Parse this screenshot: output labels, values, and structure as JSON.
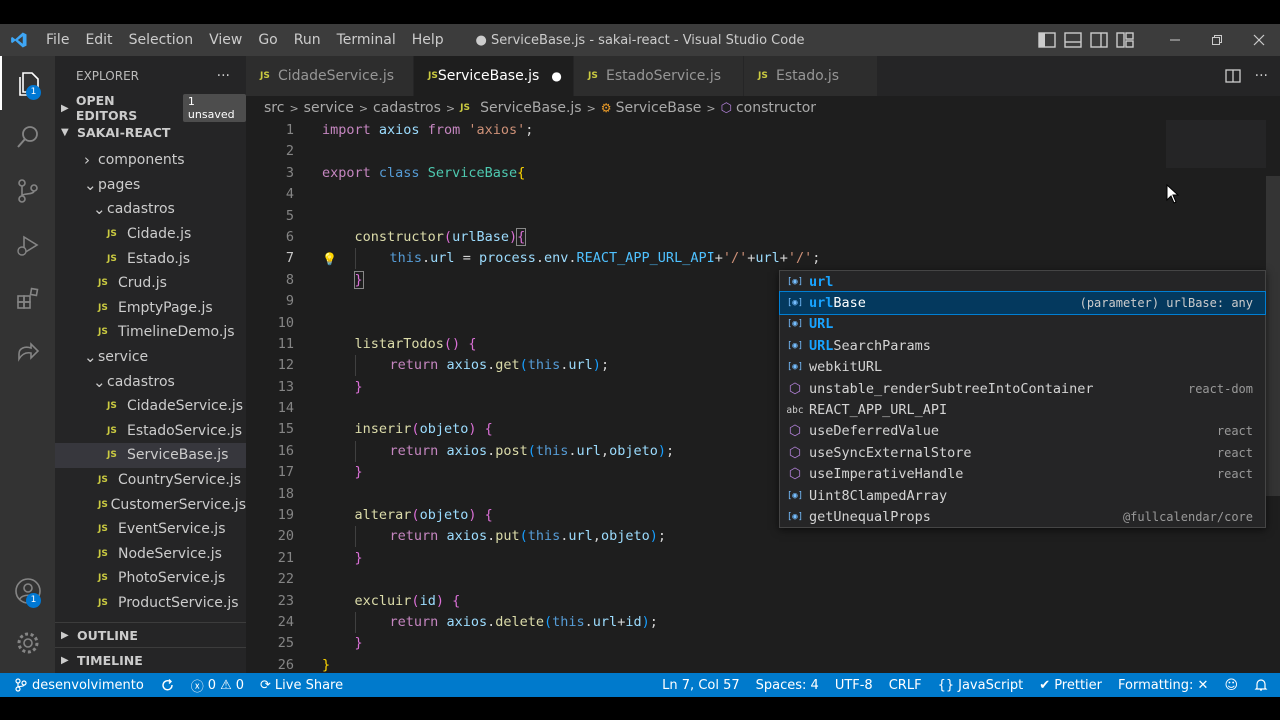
{
  "window": {
    "title": "● ServiceBase.js - sakai-react - Visual Studio Code",
    "menu": [
      "File",
      "Edit",
      "Selection",
      "View",
      "Go",
      "Run",
      "Terminal",
      "Help"
    ]
  },
  "activity_bar": {
    "items": [
      "explorer-icon",
      "search-icon",
      "source-control-icon",
      "run-debug-icon",
      "extensions-icon",
      "live-share-icon"
    ],
    "explorer_badge": "1",
    "accounts_badge": "1"
  },
  "sidebar": {
    "title": "EXPLORER",
    "more": "···",
    "open_editors": "OPEN EDITORS",
    "unsaved_badge": "1 unsaved",
    "project": "SAKAI-REACT",
    "tree": [
      {
        "label": "components",
        "type": "folder",
        "depth": 1,
        "open": false
      },
      {
        "label": "pages",
        "type": "folder",
        "depth": 1,
        "open": true
      },
      {
        "label": "cadastros",
        "type": "folder",
        "depth": 2,
        "open": true
      },
      {
        "label": "Cidade.js",
        "type": "file",
        "depth": 3
      },
      {
        "label": "Estado.js",
        "type": "file",
        "depth": 3
      },
      {
        "label": "Crud.js",
        "type": "file",
        "depth": 2
      },
      {
        "label": "EmptyPage.js",
        "type": "file",
        "depth": 2
      },
      {
        "label": "TimelineDemo.js",
        "type": "file",
        "depth": 2
      },
      {
        "label": "service",
        "type": "folder",
        "depth": 1,
        "open": true
      },
      {
        "label": "cadastros",
        "type": "folder",
        "depth": 2,
        "open": true
      },
      {
        "label": "CidadeService.js",
        "type": "file",
        "depth": 3
      },
      {
        "label": "EstadoService.js",
        "type": "file",
        "depth": 3
      },
      {
        "label": "ServiceBase.js",
        "type": "file",
        "depth": 3,
        "selected": true
      },
      {
        "label": "CountryService.js",
        "type": "file",
        "depth": 2
      },
      {
        "label": "CustomerService.js",
        "type": "file",
        "depth": 2
      },
      {
        "label": "EventService.js",
        "type": "file",
        "depth": 2
      },
      {
        "label": "NodeService.js",
        "type": "file",
        "depth": 2
      },
      {
        "label": "PhotoService.js",
        "type": "file",
        "depth": 2
      },
      {
        "label": "ProductService.js",
        "type": "file",
        "depth": 2
      }
    ],
    "outline": "OUTLINE",
    "timeline": "TIMELINE",
    "js_icon": "JS"
  },
  "tabs": [
    {
      "label": "CidadeService.js",
      "active": false
    },
    {
      "label": "ServiceBase.js",
      "active": true,
      "dirty": true
    },
    {
      "label": "EstadoService.js",
      "active": false
    },
    {
      "label": "Estado.js",
      "active": false
    }
  ],
  "breadcrumb": [
    "src",
    "service",
    "cadastros",
    "ServiceBase.js",
    "ServiceBase",
    "constructor"
  ],
  "code": {
    "line_numbers": [
      "1",
      "2",
      "3",
      "4",
      "5",
      "6",
      "7",
      "8",
      "9",
      "10",
      "11",
      "12",
      "13",
      "14",
      "15",
      "16",
      "17",
      "18",
      "19",
      "20",
      "21",
      "22",
      "23",
      "24",
      "25",
      "26"
    ],
    "current_line": "7"
  },
  "suggestions": [
    {
      "label": "url",
      "match": "url",
      "rest": "",
      "icon": "variable",
      "detail": ""
    },
    {
      "label": "urlBase",
      "match": "url",
      "rest": "Base",
      "icon": "variable",
      "detail": "(parameter) urlBase: any",
      "selected": true
    },
    {
      "label": "URL",
      "match": "URL",
      "rest": "",
      "icon": "variable",
      "detail": ""
    },
    {
      "label": "URLSearchParams",
      "match": "URL",
      "rest": "SearchParams",
      "icon": "variable",
      "detail": ""
    },
    {
      "label": "webkitURL",
      "match": "",
      "rest": "webkitURL",
      "icon": "variable",
      "detail": ""
    },
    {
      "label": "unstable_renderSubtreeIntoContainer",
      "match": "",
      "rest": "unstable_renderSubtreeIntoContainer",
      "icon": "method",
      "detail": "react-dom"
    },
    {
      "label": "REACT_APP_URL_API",
      "match": "",
      "rest": "REACT_APP_URL_API",
      "icon": "abc",
      "detail": ""
    },
    {
      "label": "useDeferredValue",
      "match": "",
      "rest": "useDeferredValue",
      "icon": "method",
      "detail": "react"
    },
    {
      "label": "useSyncExternalStore",
      "match": "",
      "rest": "useSyncExternalStore",
      "icon": "method",
      "detail": "react"
    },
    {
      "label": "useImperativeHandle",
      "match": "",
      "rest": "useImperativeHandle",
      "icon": "method",
      "detail": "react"
    },
    {
      "label": "Uint8ClampedArray",
      "match": "",
      "rest": "Uint8ClampedArray",
      "icon": "variable",
      "detail": ""
    },
    {
      "label": "getUnequalProps",
      "match": "",
      "rest": "getUnequalProps",
      "icon": "variable",
      "detail": "@fullcalendar/core"
    }
  ],
  "status": {
    "branch": "desenvolvimento",
    "errors": "0",
    "warnings": "0",
    "live_share": "Live Share",
    "position": "Ln 7, Col 57",
    "spaces": "Spaces: 4",
    "encoding": "UTF-8",
    "eol": "CRLF",
    "language": "JavaScript",
    "prettier": "Prettier",
    "formatting": "Formatting: ✕"
  },
  "colors": {
    "statusbar": "#007acc",
    "activity_bar": "#333333",
    "sidebar": "#252526",
    "editor": "#1e1e1e"
  }
}
